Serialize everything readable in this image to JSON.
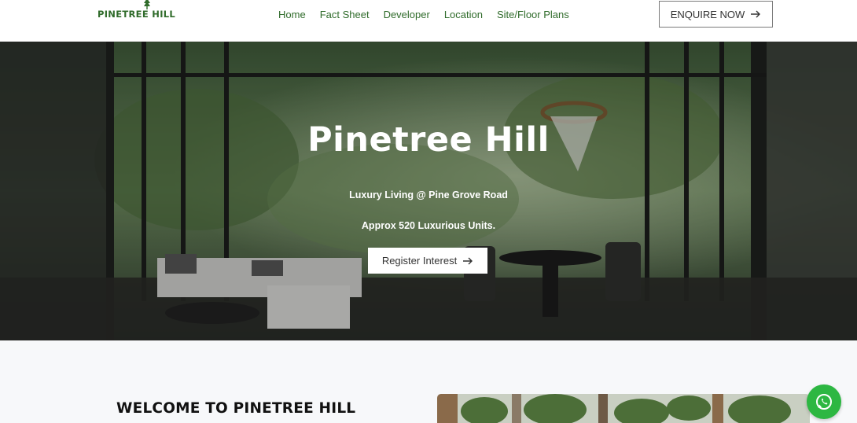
{
  "brand": {
    "name": "PINETREE HILL",
    "accent": "#2f6b2a"
  },
  "nav": {
    "items": [
      {
        "label": "Home"
      },
      {
        "label": "Fact Sheet"
      },
      {
        "label": "Developer"
      },
      {
        "label": "Location"
      },
      {
        "label": "Site/Floor Plans"
      }
    ]
  },
  "header": {
    "enquire_label": "ENQUIRE NOW"
  },
  "hero": {
    "title": "Pinetree Hill",
    "subtitle1": "Luxury Living @ Pine Grove Road",
    "subtitle2": "Approx 520 Luxurious Units.",
    "cta_label": "Register Interest"
  },
  "welcome": {
    "title": "WELCOME TO PINETREE HILL"
  },
  "floating": {
    "whatsapp_icon": "whatsapp-icon",
    "whatsapp_color": "#2db742"
  }
}
